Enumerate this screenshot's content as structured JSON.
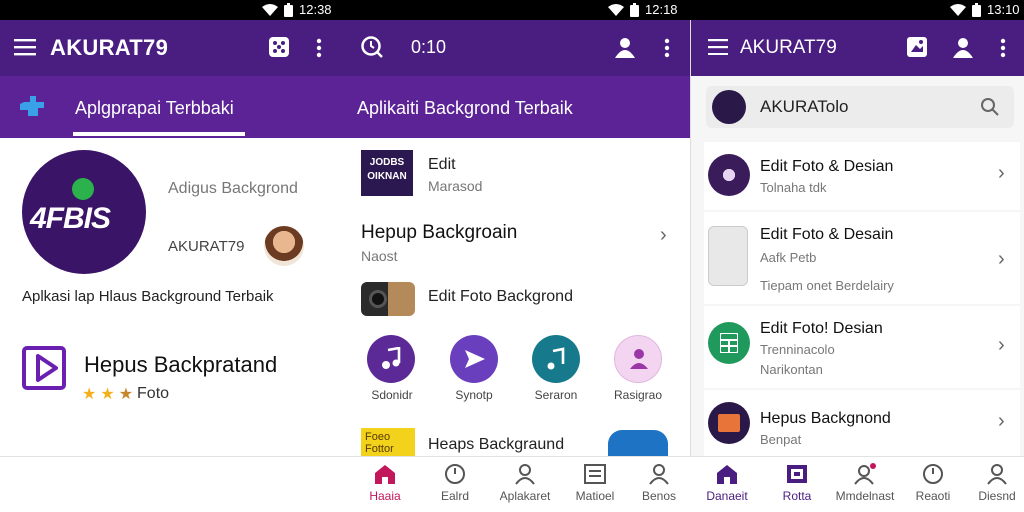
{
  "status_bar": [
    {
      "time": "12:38"
    },
    {
      "time": "12:18"
    },
    {
      "time": "13:10"
    }
  ],
  "panel1": {
    "app_title": "AKURAT79",
    "tab_active": "Aplgprapai Terbbaki",
    "logo_text": "4FBIS",
    "logo_subtitle": "Adigus Backgrond",
    "user_name": "AKURAT79",
    "description": "Aplkasi lap Hlaus Background Terbaik",
    "feature_title": "Hepus Backpratand",
    "feature_sub": "Foto",
    "rating_stars": 3
  },
  "panel2": {
    "timer": "0:10",
    "tab_active": "Aplikaiti Backgrond Terbaik",
    "item1": {
      "title": "Edit",
      "subtitle": "Marasod",
      "thumb_text": "JODBS OIKNAN"
    },
    "section_title": "Hepup Backgroain",
    "section_sub": "Naost",
    "item2": {
      "title": "Edit Foto Backgrond"
    },
    "circle_buttons": [
      {
        "label": "Sdonidr",
        "color": "#5b2a96"
      },
      {
        "label": "Synotp",
        "color": "#6a3fbd"
      },
      {
        "label": "Seraron",
        "color": "#167a8c"
      },
      {
        "label": "Rasigrao",
        "color": "#f3d5f2"
      }
    ],
    "item3": {
      "title": "Heaps Backgraund",
      "thumb_text": "Foeo Fottor"
    }
  },
  "panel3": {
    "app_title": "AKURAT79",
    "search_text": "AKURATolo",
    "list": [
      {
        "title": "Edit Foto & Desian",
        "line1": "Tolnaha tdk",
        "line2": ""
      },
      {
        "title": "Edit Foto & Desain",
        "line1": "Aafk Petb",
        "line2": "Tiepam onet Berdelairy"
      },
      {
        "title": "Edit Foto! Desian",
        "line1": "Trenninacolo",
        "line2": "Narikontan"
      },
      {
        "title": "Hepus Backgnond",
        "line1": "Benpat",
        "line2": ""
      }
    ]
  },
  "bottom_nav": [
    {
      "label": "Haaia",
      "icon": "home-icon"
    },
    {
      "label": "Ealrd",
      "icon": "clock-icon"
    },
    {
      "label": "Aplakaret",
      "icon": "person-icon"
    },
    {
      "label": "Matioel",
      "icon": "doc-icon"
    },
    {
      "label": "Benos",
      "icon": "person-icon"
    },
    {
      "label": "Danaeit",
      "icon": "home-icon"
    },
    {
      "label": "Rotta",
      "icon": "grid-icon"
    },
    {
      "label": "Mmdelnast",
      "icon": "person-badge-icon"
    },
    {
      "label": "Reaoti",
      "icon": "clock-icon"
    },
    {
      "label": "Diesnd",
      "icon": "person-icon"
    }
  ],
  "colors": {
    "appbar": "#4a1d80",
    "tabbar": "#5b2396",
    "accent_pink": "#c2185b",
    "accent_purple": "#4a1d80"
  }
}
